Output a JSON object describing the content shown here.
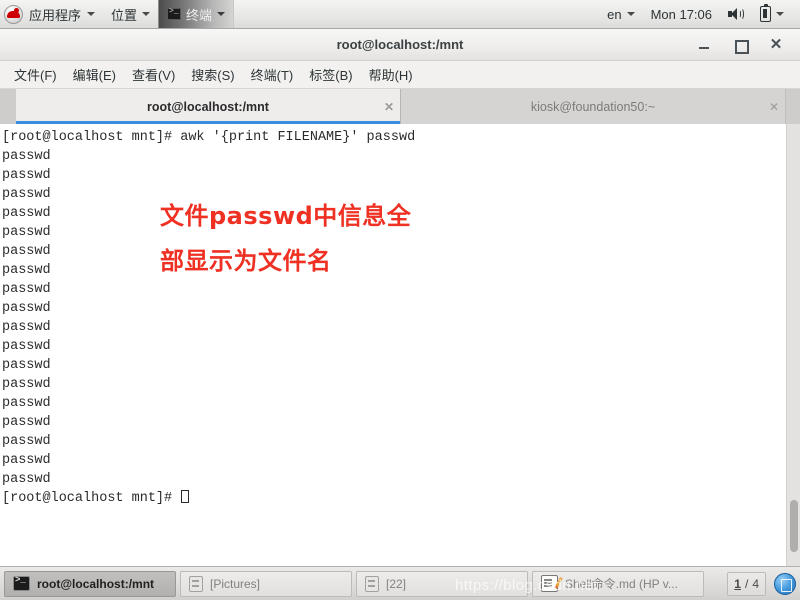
{
  "top_panel": {
    "applications_label": "应用程序",
    "places_label": "位置",
    "active_window_label": "终端",
    "keyboard_layout": "en",
    "clock": "Mon 17:06"
  },
  "window": {
    "title": "root@localhost:/mnt",
    "menus": [
      "文件(F)",
      "编辑(E)",
      "查看(V)",
      "搜索(S)",
      "终端(T)",
      "标签(B)",
      "帮助(H)"
    ],
    "buttons": {
      "minimize": "_",
      "maximize": "□",
      "close": "✕"
    }
  },
  "tabs": [
    {
      "label": "root@localhost:/mnt",
      "close": "✕",
      "active": true
    },
    {
      "label": "kiosk@foundation50:~",
      "close": "✕",
      "active": false
    }
  ],
  "terminal": {
    "prompt": "[root@localhost mnt]# ",
    "command": "awk '{print FILENAME}' passwd",
    "command_line": "[root@localhost mnt]# awk '{print FILENAME}' passwd",
    "output_value": "passwd",
    "output_line_count": 18,
    "output_lines": [
      "passwd",
      "passwd",
      "passwd",
      "passwd",
      "passwd",
      "passwd",
      "passwd",
      "passwd",
      "passwd",
      "passwd",
      "passwd",
      "passwd",
      "passwd",
      "passwd",
      "passwd",
      "passwd",
      "passwd",
      "passwd"
    ],
    "final_prompt": "[root@localhost mnt]# ",
    "text_color": "#2b2b2b",
    "background_color": "#ffffff"
  },
  "annotation": {
    "line1": "文件passwd中信息全",
    "line2": "部显示为文件名",
    "color": "#ef3124"
  },
  "taskbar": {
    "items": [
      {
        "label": "root@localhost:/mnt",
        "icon": "terminal-icon",
        "active": true
      },
      {
        "label": "[Pictures]",
        "icon": "file-manager-icon",
        "active": false
      },
      {
        "label": "[22]",
        "icon": "file-manager-icon",
        "active": false
      },
      {
        "label": "Shell命令.md (HP v...",
        "icon": "notepad-icon",
        "active": false
      }
    ],
    "workspace_current": "1",
    "workspace_separator": "/",
    "workspace_total": "4"
  },
  "watermark": "https://blog.csdn.net"
}
